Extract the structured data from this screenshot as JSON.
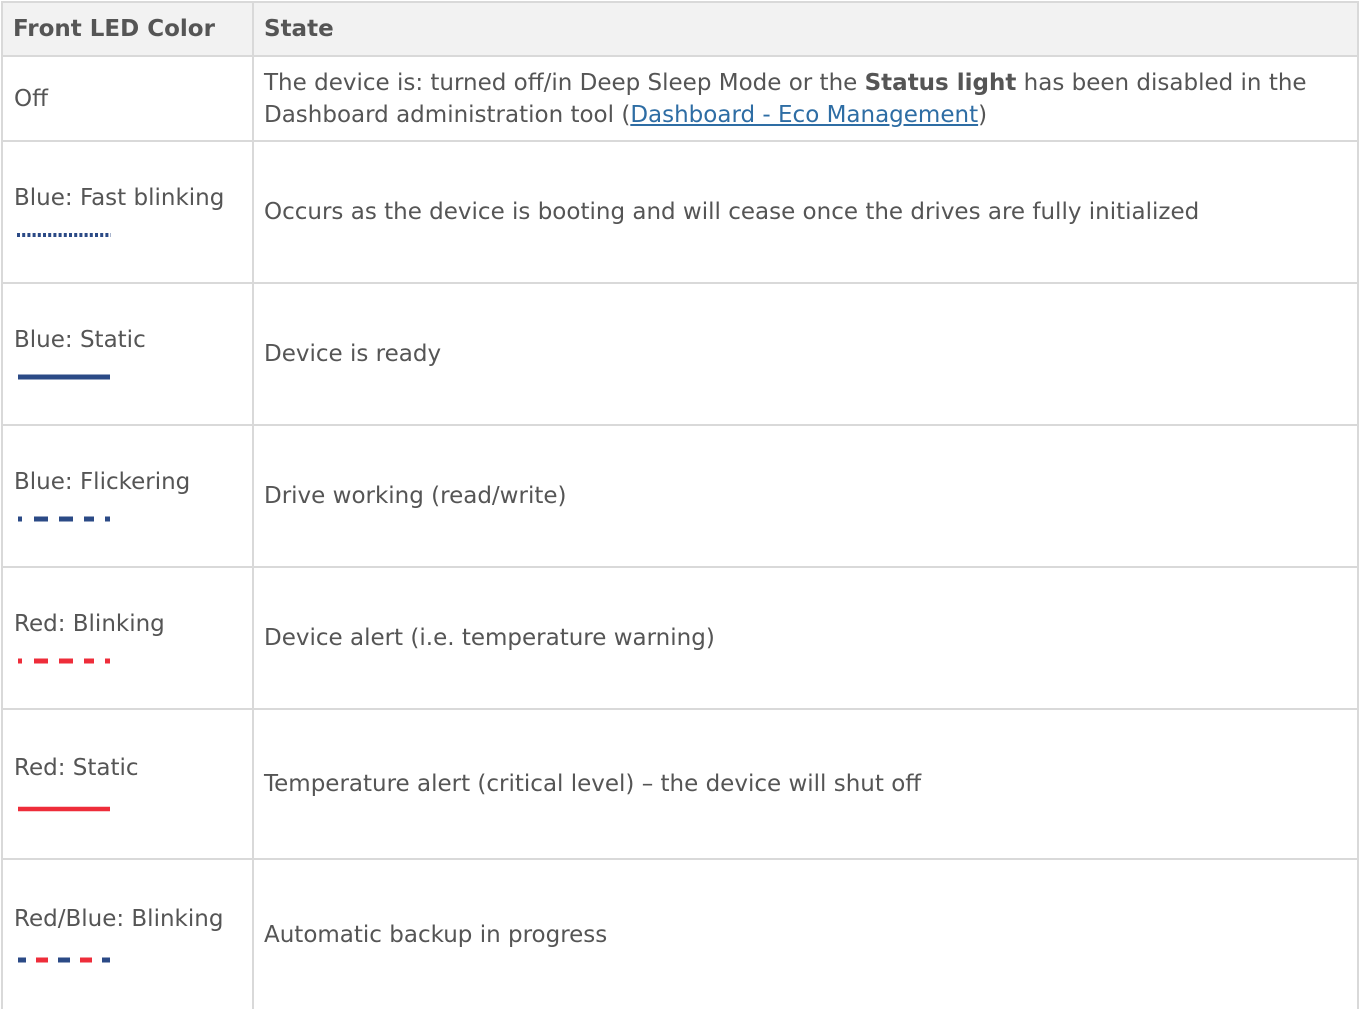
{
  "header": {
    "col1": "Front LED Color",
    "col2": "State"
  },
  "rows": [
    {
      "color": "Off",
      "state": {
        "pre": "The device is: turned off/in Deep Sleep Mode or the ",
        "bold": "Status light",
        "mid": " has been disabled in the Dashboard administration tool (",
        "link": "Dashboard - Eco Management",
        "post": ")"
      }
    },
    {
      "color": "Blue: Fast blinking",
      "state": "Occurs as the device is booting and will cease once the drives are fully initialized",
      "indicator": "blue-fast-blink-icon"
    },
    {
      "color": "Blue: Static",
      "state": "Device is ready",
      "indicator": "blue-static-icon"
    },
    {
      "color": "Blue: Flickering",
      "state": "Drive working (read/write)",
      "indicator": "blue-flicker-icon"
    },
    {
      "color": "Red: Blinking",
      "state": "Device alert (i.e. temperature warning)",
      "indicator": "red-blink-icon"
    },
    {
      "color": "Red: Static",
      "state": "Temperature alert (critical level) – the device will shut off",
      "indicator": "red-static-icon"
    },
    {
      "color": "Red/Blue: Blinking",
      "state": "Automatic backup in progress",
      "indicator": "red-blue-blink-icon"
    }
  ],
  "colors": {
    "blue": "#2b4a86",
    "red": "#ee2d3a",
    "link": "#2e6da4",
    "header_bg": "#f2f2f2",
    "border": "#d9d9d9"
  }
}
